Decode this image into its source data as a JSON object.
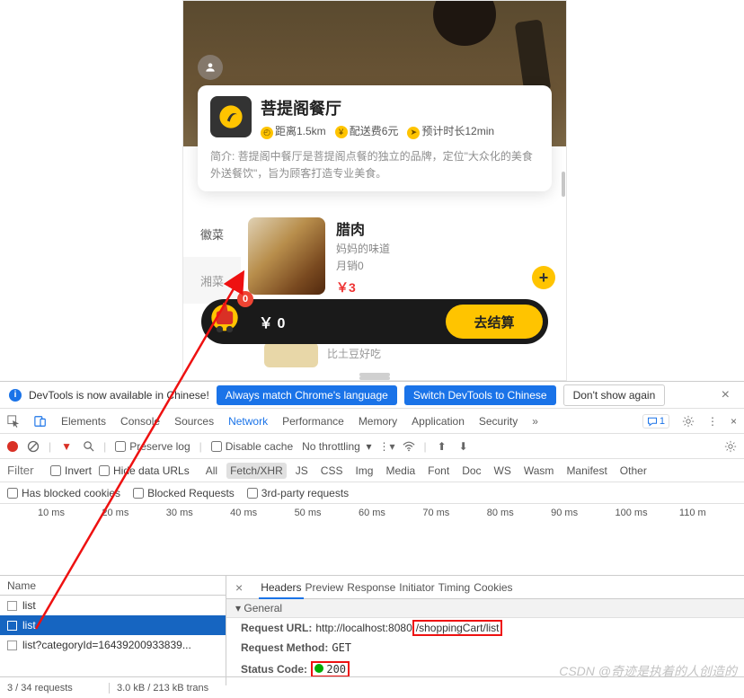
{
  "app": {
    "shop": {
      "name": "菩提阁餐厅",
      "distance_label": "距离1.5km",
      "fee_label": "配送费6元",
      "eta_label": "预计时长12min",
      "desc": "简介: 菩提阁中餐厅是菩提阁点餐的独立的品牌，定位\"大众化的美食外送餐饮\"，旨为顾客打造专业美食。"
    },
    "categories": [
      "徽菜",
      "湘菜"
    ],
    "food": {
      "name": "腊肉",
      "sub": "妈妈的味道",
      "sales": "月销0",
      "price": "￥3"
    },
    "peek_sub": "比土豆好吃",
    "cart": {
      "badge": "0",
      "total": "￥ 0",
      "checkout": "去结算"
    }
  },
  "lang": {
    "msg": "DevTools is now available in Chinese!",
    "btn1": "Always match Chrome's language",
    "btn2": "Switch DevTools to Chinese",
    "btn3": "Don't show again"
  },
  "tabs": [
    "Elements",
    "Console",
    "Sources",
    "Network",
    "Performance",
    "Memory",
    "Application",
    "Security"
  ],
  "tabs_active": "Network",
  "netbar": {
    "preserve": "Preserve log",
    "disable": "Disable cache",
    "throttle": "No throttling"
  },
  "filter": {
    "placeholder": "Filter",
    "invert": "Invert",
    "hide": "Hide data URLs",
    "types": [
      "All",
      "Fetch/XHR",
      "JS",
      "CSS",
      "Img",
      "Media",
      "Font",
      "Doc",
      "WS",
      "Wasm",
      "Manifest",
      "Other"
    ],
    "type_active": "Fetch/XHR"
  },
  "extra": {
    "blocked_cookies": "Has blocked cookies",
    "blocked_req": "Blocked Requests",
    "third": "3rd-party requests"
  },
  "timeline": [
    "10 ms",
    "20 ms",
    "30 ms",
    "40 ms",
    "50 ms",
    "60 ms",
    "70 ms",
    "80 ms",
    "90 ms",
    "100 ms",
    "110 m"
  ],
  "reqs": {
    "header": "Name",
    "rows": [
      {
        "label": "list",
        "sel": false
      },
      {
        "label": "list",
        "sel": true
      },
      {
        "label": "list?categoryId=16439200933839...",
        "sel": false
      }
    ]
  },
  "det_tabs": [
    "Headers",
    "Preview",
    "Response",
    "Initiator",
    "Timing",
    "Cookies"
  ],
  "det_tabs_active": "Headers",
  "general": {
    "title": "General",
    "url_k": "Request URL:",
    "url_v1": "http://localhost:8080",
    "url_v2": "/shoppingCart/list",
    "method_k": "Request Method:",
    "method_v": "GET",
    "status_k": "Status Code:",
    "status_v": "200"
  },
  "status": {
    "reqs": "3 / 34 requests",
    "transfer": "3.0 kB / 213 kB trans"
  },
  "msg_badge": "1",
  "watermark": "CSDN @奇迹是执着的人创造的"
}
